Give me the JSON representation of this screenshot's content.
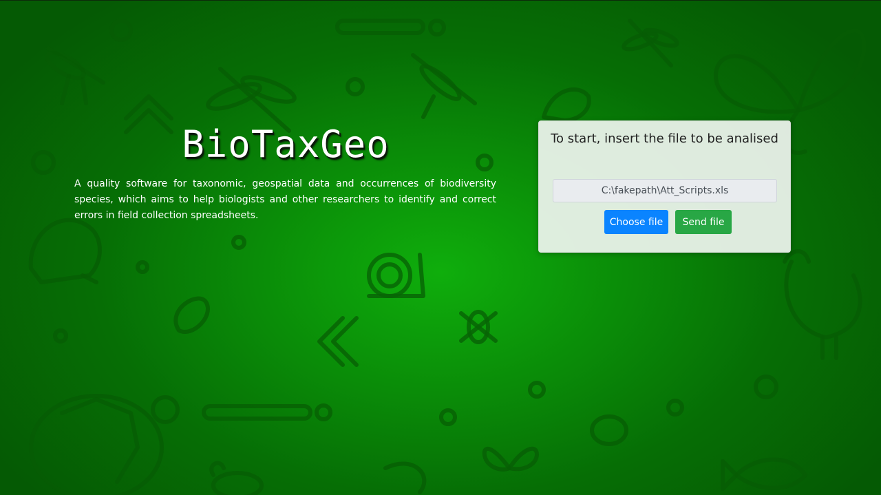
{
  "hero": {
    "title": "BioTaxGeo",
    "description": "A quality software for taxonomic, geospatial data and occurrences of biodiversity species, which aims to help biologists and other researchers to identify and correct errors in field collection spreadsheets."
  },
  "upload": {
    "heading": "To start, insert the file to be analised",
    "file_value": "C:\\fakepath\\Att_Scripts.xls",
    "choose_label": "Choose file",
    "send_label": "Send file"
  },
  "colors": {
    "background": "#0a8c08",
    "choose_button": "#0a84ff",
    "send_button": "#28a745"
  },
  "background_icons": [
    "mosquito-icon",
    "dragonfly-icon",
    "butterfly-icon",
    "frog-icon",
    "snail-icon",
    "lizard-icon",
    "turtle-icon",
    "rooster-icon",
    "fish-icon",
    "beetle-icon",
    "crab-icon",
    "shrimp-icon",
    "chevron-up-icon",
    "double-chevron-left-icon"
  ]
}
